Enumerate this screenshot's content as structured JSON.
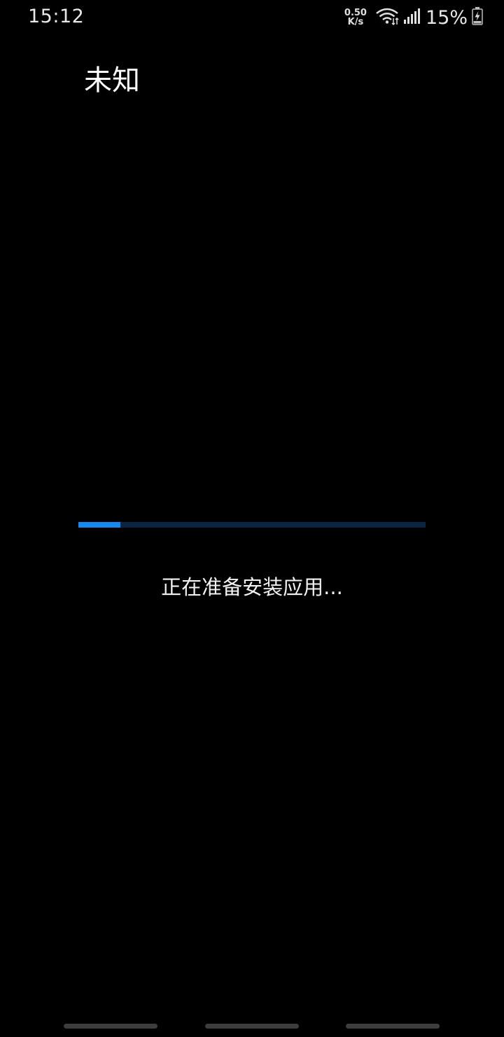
{
  "status_bar": {
    "time": "15:12",
    "net_speed_value": "0.50",
    "net_speed_unit": "K/s",
    "battery_percent": "15%",
    "icons": [
      "wifi-icon",
      "signal-icon",
      "battery-charging-icon"
    ]
  },
  "app": {
    "title": "未知"
  },
  "install": {
    "progress": 0.12,
    "message": "正在准备安装应用..."
  },
  "nav_bar": {
    "items": [
      "back-gesture-handle",
      "home-gesture-handle",
      "recents-gesture-handle"
    ]
  },
  "colors": {
    "background": "#000000",
    "progress_accent": "#1589f0",
    "progress_track": "#0b2442"
  }
}
